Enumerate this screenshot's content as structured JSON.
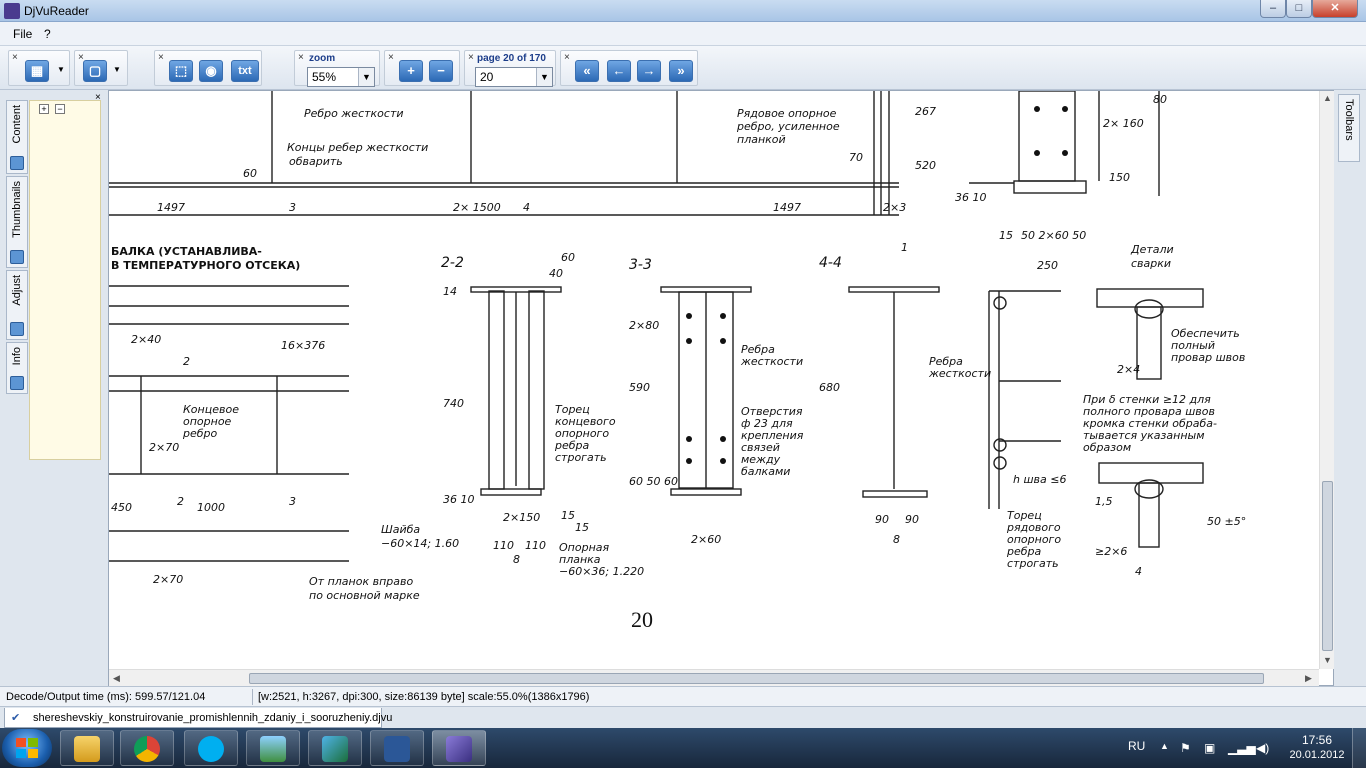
{
  "window": {
    "title": "DjVuReader",
    "min": "–",
    "max": "□",
    "close": "✕"
  },
  "menu": {
    "file": "File",
    "help": "?"
  },
  "toolbar": {
    "close_glyph": "×",
    "zoom_label": "zoom",
    "zoom_value": "55%",
    "page_label": "page 20 of 170",
    "page_value": "20",
    "text_button": "txt",
    "zoom_in": "+",
    "zoom_out": "−",
    "first_page": "«",
    "prev_page": "←",
    "next_page": "→",
    "last_page": "»"
  },
  "sidebar": {
    "close_glyph": "×",
    "tabs": [
      "Content",
      "Thumbnails",
      "Adjust",
      "Info"
    ],
    "expand": "+",
    "collapse": "−"
  },
  "rightbar": {
    "toolbars_label": "Toolbars"
  },
  "document": {
    "page_number": "20",
    "labels": {
      "l1": "Ребро жесткости",
      "l2": "Концы ребер жесткости",
      "l3": "обварить",
      "l4": "Рядовое опорное",
      "l5": "ребро, усиленное",
      "l6": "планкой",
      "l7": "БАЛКА (УСТАНАВЛИВА-",
      "l8": "В ТЕМПЕРАТУРНОГО ОТСЕКА)",
      "l9": "Концевое",
      "l10": "опорное",
      "l11": "ребро",
      "l12": "2-2",
      "l13": "3-3",
      "l14": "4-4",
      "l15": "Торец",
      "l16": "концевого",
      "l17": "опорного",
      "l18": "ребра",
      "l19": "строгать",
      "l20": "Ребра",
      "l21": "жесткости",
      "l22": "Отверстия",
      "l23": "ф 23 для",
      "l24": "крепления",
      "l25": "связей",
      "l26": "между",
      "l27": "балками",
      "l28": "Ребра",
      "l29": "жесткости",
      "l30": "Детали",
      "l31": "сварки",
      "l32": "Обеспечить",
      "l33": "полный",
      "l34": "провар швов",
      "l35": "При δ стенки ≥12 для",
      "l36": "полного провара швов",
      "l37": "кромка стенки обраба-",
      "l38": "тывается указанным",
      "l39": "образом",
      "l40": "h шва ≤6",
      "l41": "Торец",
      "l42": "рядового",
      "l43": "опорного",
      "l44": "ребра",
      "l45": "строгать",
      "l46": "Шайба",
      "l47": "−60×14; 1.60",
      "l48": "Опорная",
      "l49": "планка",
      "l50": "−60×36; 1.220",
      "l51": "От планок вправо",
      "l52": "по основной марке",
      "d1": "1497",
      "d2": "2× 1500",
      "d3": "1497",
      "d4": "2×3",
      "d5": "60",
      "d6": "70",
      "d7": "520",
      "d8": "267",
      "d9": "2×40",
      "d10": "16×376",
      "d11": "2×70",
      "d12": "450",
      "d13": "1000",
      "d14": "2×70",
      "d15": "740",
      "d16": "590",
      "d17": "680",
      "d18": "2×60",
      "d19": "90",
      "d20": "90",
      "d21": "8",
      "d22": "8",
      "d23": "110",
      "d24": "110",
      "d25": "2×150",
      "d26": "250",
      "d27": "15",
      "d28": "50 2×60 50",
      "d29": "2×4",
      "d30": "50 ±5°",
      "d31": "≥2×6",
      "d32": "4",
      "d33": "1,5",
      "d34": "60",
      "d35": "40",
      "d36": "14",
      "d37": "36 10",
      "d38": "60 50 60",
      "d39": "2×80",
      "d40": "150",
      "d41": "2× 160",
      "d42": "80",
      "d43": "36 10",
      "d44": "15",
      "d45": "15",
      "d46": "2",
      "d47": "3",
      "d48": "2",
      "d49": "3",
      "d50": "1",
      "d51": "4"
    }
  },
  "status": {
    "decode": "Decode/Output time (ms): 599.57/121.04",
    "info": "[w:2521, h:3267, dpi:300, size:86139 byte] scale:55.0%(1386x1796)"
  },
  "file_tab": {
    "icon": "✔",
    "label": "shereshevskiy_konstruirovanie_promishlennih_zdaniy_i_sooruzheniy.djvu"
  },
  "taskbar": {
    "apps": [
      "Explorer",
      "Chrome",
      "Skype",
      "Photos",
      "Quill",
      "Word",
      "DjVuReader"
    ],
    "lang": "RU",
    "time": "17:56",
    "date": "20.01.2012"
  },
  "colors": {
    "accent": "#2c69b5",
    "taskbar": "#18273b",
    "sidebar_pane": "#fffbe6"
  }
}
